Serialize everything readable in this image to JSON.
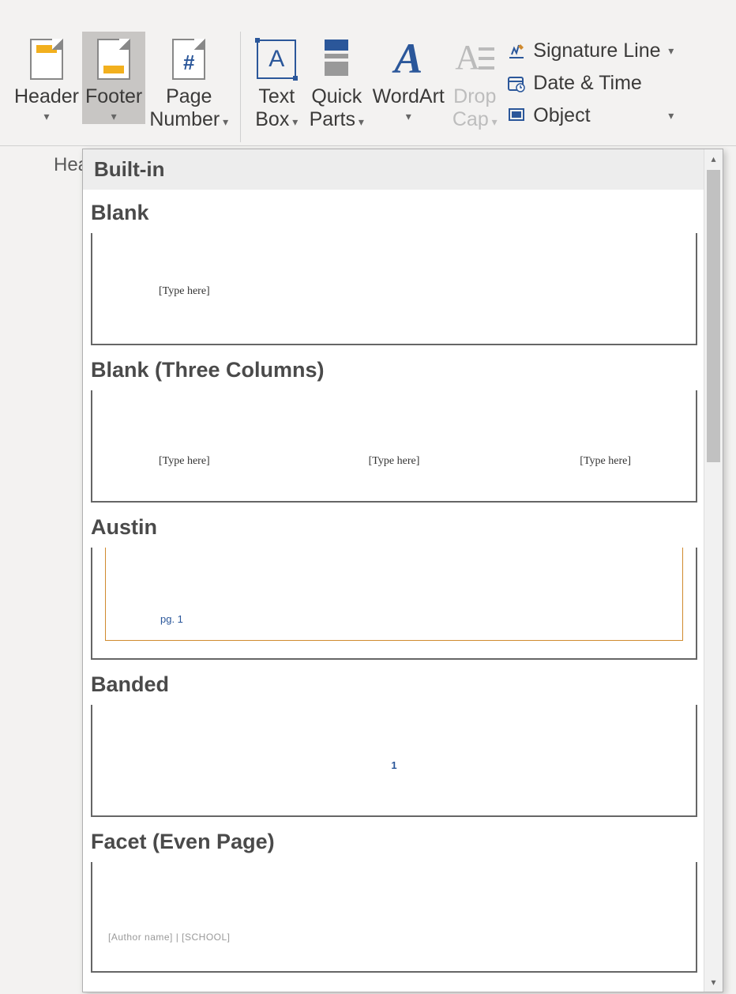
{
  "ribbon": {
    "header_label": "Header",
    "footer_label": "Footer",
    "page_number_label_l1": "Page",
    "page_number_label_l2": "Number",
    "text_box_label_l1": "Text",
    "text_box_label_l2": "Box",
    "quick_parts_label_l1": "Quick",
    "quick_parts_label_l2": "Parts",
    "wordart_label": "WordArt",
    "drop_cap_label_l1": "Drop",
    "drop_cap_label_l2": "Cap",
    "signature_line_label": "Signature Line",
    "date_time_label": "Date & Time",
    "object_label": "Object",
    "group_label_partial": "Hea",
    "textbox_glyph": "A",
    "wordart_glyph": "A"
  },
  "gallery": {
    "header": "Built-in",
    "items": [
      {
        "title": "Blank",
        "type": "single",
        "placeholder": "[Type here]"
      },
      {
        "title": "Blank (Three Columns)",
        "type": "three",
        "placeholder1": "[Type here]",
        "placeholder2": "[Type here]",
        "placeholder3": "[Type here]"
      },
      {
        "title": "Austin",
        "type": "austin",
        "page_text": "pg. 1"
      },
      {
        "title": "Banded",
        "type": "banded",
        "page_number": "1"
      },
      {
        "title": "Facet (Even Page)",
        "type": "facet",
        "meta_text": "[Author name] | [SCHOOL]"
      }
    ]
  }
}
